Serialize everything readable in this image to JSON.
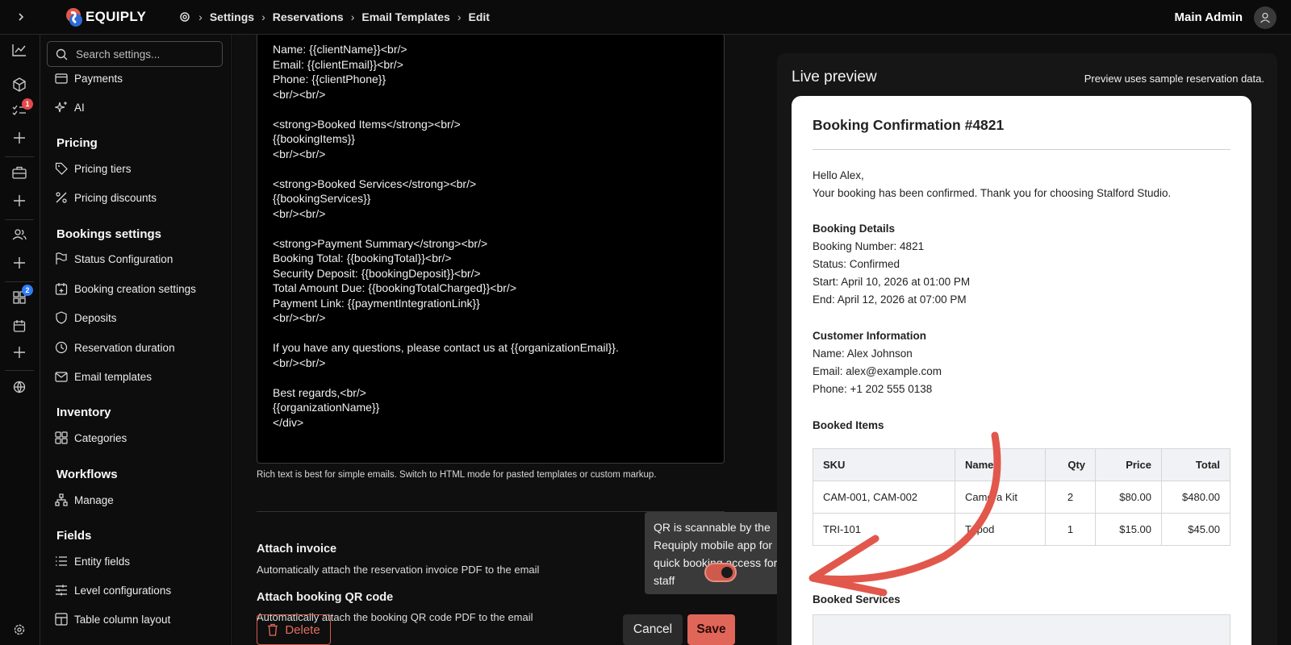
{
  "app": {
    "name": "EQUIPLY"
  },
  "breadcrumb": [
    "Settings",
    "Reservations",
    "Email Templates",
    "Edit"
  ],
  "user": {
    "name": "Main Admin"
  },
  "rail": {
    "tasks_badge": "1",
    "apps_badge": "2"
  },
  "search": {
    "placeholder": "Search settings..."
  },
  "sidebar": {
    "top_items": [
      "Payments",
      "AI"
    ],
    "pricing": {
      "title": "Pricing",
      "items": [
        "Pricing tiers",
        "Pricing discounts"
      ]
    },
    "bookings": {
      "title": "Bookings settings",
      "items": [
        "Status Configuration",
        "Booking creation settings",
        "Deposits",
        "Reservation duration",
        "Email templates"
      ]
    },
    "inventory": {
      "title": "Inventory",
      "items": [
        "Categories"
      ]
    },
    "workflows": {
      "title": "Workflows",
      "items": [
        "Manage"
      ]
    },
    "fields": {
      "title": "Fields",
      "items": [
        "Entity fields",
        "Level configurations",
        "Table column layout"
      ]
    }
  },
  "editor": {
    "content": "Name: {{clientName}}<br/>\nEmail: {{clientEmail}}<br/>\nPhone: {{clientPhone}}\n<br/><br/>\n\n<strong>Booked Items</strong><br/>\n{{bookingItems}}\n<br/><br/>\n\n<strong>Booked Services</strong><br/>\n{{bookingServices}}\n<br/><br/>\n\n<strong>Payment Summary</strong><br/>\nBooking Total: {{bookingTotal}}<br/>\nSecurity Deposit: {{bookingDeposit}}<br/>\nTotal Amount Due: {{bookingTotalCharged}}<br/>\nPayment Link: {{paymentIntegrationLink}}\n<br/><br/>\n\nIf you have any questions, please contact us at {{organizationEmail}}.\n<br/><br/>\n\nBest regards,<br/>\n{{organizationName}}\n</div>",
    "hint": "Rich text is best for simple emails. Switch to HTML mode for pasted templates or custom markup."
  },
  "options": {
    "invoice": {
      "title": "Attach invoice",
      "desc": "Automatically attach the reservation invoice PDF to the email"
    },
    "qr": {
      "title": "Attach booking QR code",
      "desc": "Automatically attach the booking QR code PDF to the email",
      "enabled": true
    }
  },
  "tooltip": "QR is scannable by the Requiply mobile app for quick booking access for staff",
  "buttons": {
    "delete": "Delete",
    "cancel": "Cancel",
    "save": "Save"
  },
  "preview": {
    "title": "Live preview",
    "note": "Preview uses sample reservation data.",
    "email": {
      "heading": "Booking Confirmation #4821",
      "greeting": "Hello Alex,",
      "intro": "Your booking has been confirmed. Thank you for choosing Stalford Studio.",
      "details_title": "Booking Details",
      "details": [
        "Booking Number: 4821",
        "Status: Confirmed",
        "Start: April 10, 2026 at 01:00 PM",
        "End: April 12, 2026 at 07:00 PM"
      ],
      "customer_title": "Customer Information",
      "customer": [
        "Name: Alex Johnson",
        "Email: alex@example.com",
        "Phone: +1 202 555 0138"
      ],
      "items_title": "Booked Items",
      "items_headers": [
        "SKU",
        "Name",
        "Qty",
        "Price",
        "Total"
      ],
      "items_rows": [
        [
          "CAM-001, CAM-002",
          "Camera Kit",
          "2",
          "$80.00",
          "$480.00"
        ],
        [
          "TRI-101",
          "Tripod",
          "1",
          "$15.00",
          "$45.00"
        ]
      ],
      "services_title": "Booked Services"
    }
  },
  "colors": {
    "accent": "#e0665a",
    "badge_red": "#e5484d",
    "badge_blue": "#2f7cf6",
    "annotation_arrow": "#e2574c"
  }
}
